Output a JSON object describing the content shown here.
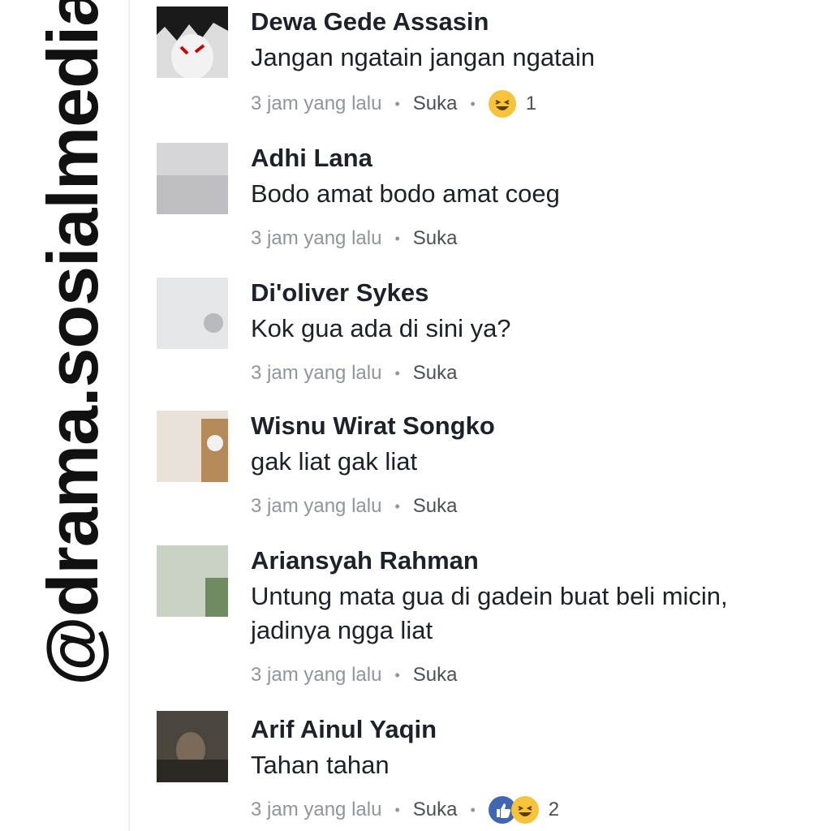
{
  "watermark": "@drama.sosialmedia",
  "comments": [
    {
      "name": "Dewa Gede Assasin",
      "text": "Jangan ngatain jangan ngatain",
      "time": "3 jam yang lalu",
      "like": "Suka",
      "reaction_count": "1"
    },
    {
      "name": "Adhi Lana",
      "text": "Bodo amat bodo amat coeg",
      "time": "3 jam yang lalu",
      "like": "Suka"
    },
    {
      "name": "Di'oliver Sykes",
      "text": "Kok gua ada di sini ya?",
      "time": "3 jam yang lalu",
      "like": "Suka"
    },
    {
      "name": "Wisnu Wirat Songko",
      "text": "gak liat gak liat",
      "time": "3 jam yang lalu",
      "like": "Suka"
    },
    {
      "name": "Ariansyah Rahman",
      "text": "Untung mata gua di gadein buat beli micin, jadinya ngga liat",
      "time": "3 jam yang lalu",
      "like": "Suka"
    },
    {
      "name": "Arif Ainul Yaqin",
      "text": "Tahan tahan",
      "time": "3 jam yang lalu",
      "like": "Suka",
      "reaction_count": "2"
    }
  ],
  "colors": {
    "name": "#1d2129",
    "meta": "#90949c",
    "haha": "#f7c33b",
    "like": "#4267b2"
  },
  "icons": [
    "haha-reaction-icon",
    "like-reaction-icon"
  ]
}
